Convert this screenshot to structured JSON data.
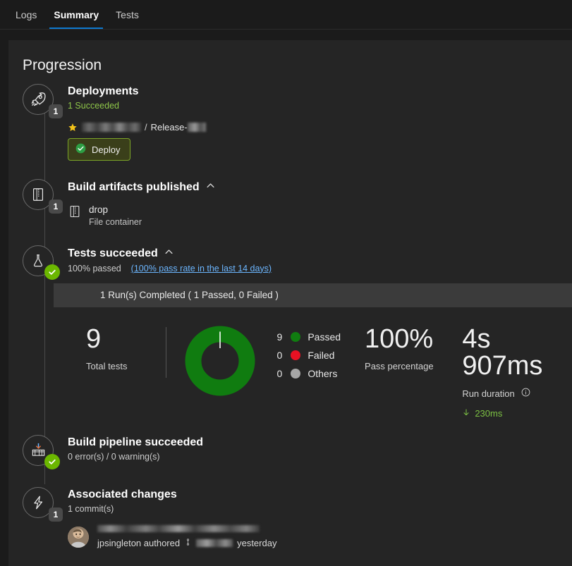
{
  "tabs": [
    {
      "label": "Logs",
      "active": false
    },
    {
      "label": "Summary",
      "active": true
    },
    {
      "label": "Tests",
      "active": false
    }
  ],
  "card": {
    "title": "Progression"
  },
  "colors": {
    "accent": "#0e7ad1",
    "passed": "#107c10",
    "failed": "#e81123",
    "others": "#a6a6a6",
    "success_text": "#8ec549",
    "link": "#6cb6ff",
    "badge_check": "#6bb700"
  },
  "deployments": {
    "title": "Deployments",
    "status": "1 Succeeded",
    "badge": "1",
    "icon": "rocket-icon",
    "release_separator": "/",
    "release_prefix": "Release-",
    "button_label": "Deploy"
  },
  "artifacts": {
    "title": "Build artifacts published",
    "badge": "1",
    "icon": "archive-icon",
    "items": [
      {
        "name": "drop",
        "type": "File container"
      }
    ]
  },
  "tests": {
    "title": "Tests succeeded",
    "status": "100% passed",
    "pass_rate_link": "(100% pass rate in the last 14 days)",
    "icon": "flask-icon",
    "run_summary": "1 Run(s) Completed ( 1 Passed, 0 Failed )",
    "total_tests_value": "9",
    "total_tests_label": "Total tests",
    "pass_percentage_value": "100%",
    "pass_percentage_label": "Pass percentage",
    "run_duration_value": "4s 907ms",
    "run_duration_label": "Run duration",
    "run_duration_delta": "230ms",
    "legend": [
      {
        "count": "9",
        "label": "Passed",
        "color": "#107c10"
      },
      {
        "count": "0",
        "label": "Failed",
        "color": "#e81123"
      },
      {
        "count": "0",
        "label": "Others",
        "color": "#a6a6a6"
      }
    ]
  },
  "chart_data": {
    "type": "pie",
    "title": "Test results",
    "categories": [
      "Passed",
      "Failed",
      "Others"
    ],
    "values": [
      9,
      0,
      0
    ],
    "colors": [
      "#107c10",
      "#e81123",
      "#a6a6a6"
    ],
    "total": 9,
    "legend_position": "right"
  },
  "build": {
    "title": "Build pipeline succeeded",
    "status": "0 error(s) / 0 warning(s)",
    "icon": "build-factory-icon"
  },
  "changes": {
    "title": "Associated changes",
    "status": "1 commit(s)",
    "badge": "1",
    "icon": "bolt-icon",
    "commit": {
      "author": "jpsingleton authored",
      "time": "yesterday"
    }
  }
}
